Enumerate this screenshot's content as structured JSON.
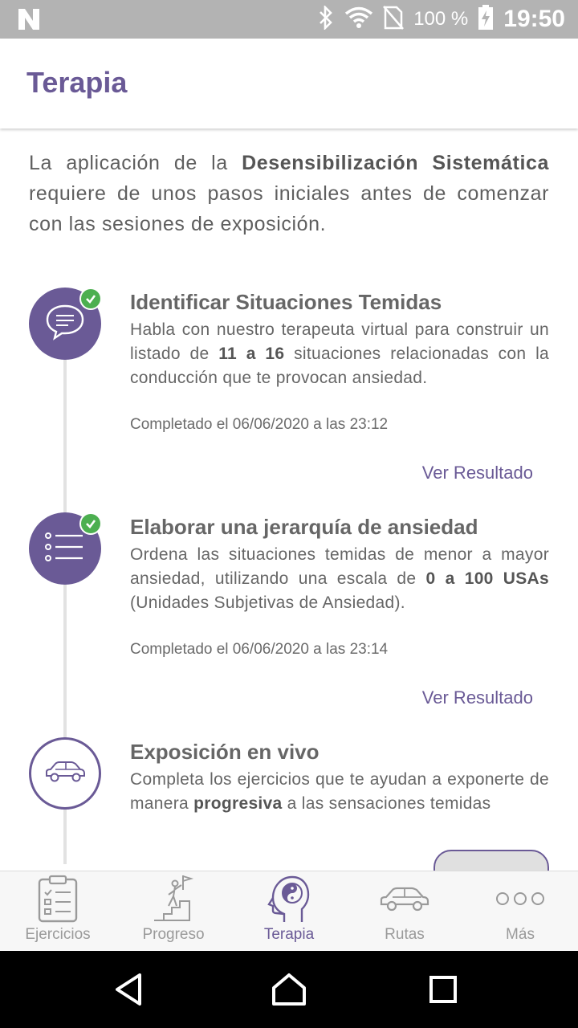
{
  "status_bar": {
    "battery": "100 %",
    "time": "19:50"
  },
  "app_bar": {
    "title": "Terapia"
  },
  "intro": {
    "text_before": "La aplicación de la ",
    "text_bold": "Desensibilización Sistemática",
    "text_after": " requiere de unos pasos iniciales antes de comenzar con las sesiones de exposición."
  },
  "steps": [
    {
      "icon": "chat-bubble-icon",
      "completed": true,
      "title": "Identificar Situaciones Temidas",
      "desc_1": "Habla con nuestro terapeuta virtual para construir un listado de ",
      "desc_bold": "11 a 16",
      "desc_2": " situaciones relacionadas con la conducción que te provocan ansiedad.",
      "completed_text": "Completado el 06/06/2020 a las 23:12",
      "link": "Ver Resultado"
    },
    {
      "icon": "list-icon",
      "completed": true,
      "title": "Elaborar una jerarquía de ansiedad",
      "desc_1": "Ordena las situaciones temidas de menor a mayor ansiedad, utilizando una escala de ",
      "desc_bold": "0 a 100 USAs",
      "desc_2": " (Unidades Subjetivas de Ansiedad).",
      "completed_text": "Completado el 06/06/2020 a las 23:14",
      "link": "Ver Resultado"
    },
    {
      "icon": "car-icon",
      "completed": false,
      "title": "Exposición en vivo",
      "desc_1": "Completa los ejercicios que te ayudan a exponerte de manera ",
      "desc_bold": "progresiva",
      "desc_2": " a las sensaciones temidas"
    }
  ],
  "bottom_nav": [
    {
      "label": "Ejercicios",
      "icon": "clipboard-icon"
    },
    {
      "label": "Progreso",
      "icon": "climber-icon"
    },
    {
      "label": "Terapia",
      "icon": "head-yin-yang-icon",
      "active": true
    },
    {
      "label": "Rutas",
      "icon": "car-icon"
    },
    {
      "label": "Más",
      "icon": "more-dots-icon"
    }
  ],
  "colors": {
    "accent": "#6a5a96",
    "check": "#4caf50",
    "status_bar": "#b3b3b3"
  }
}
